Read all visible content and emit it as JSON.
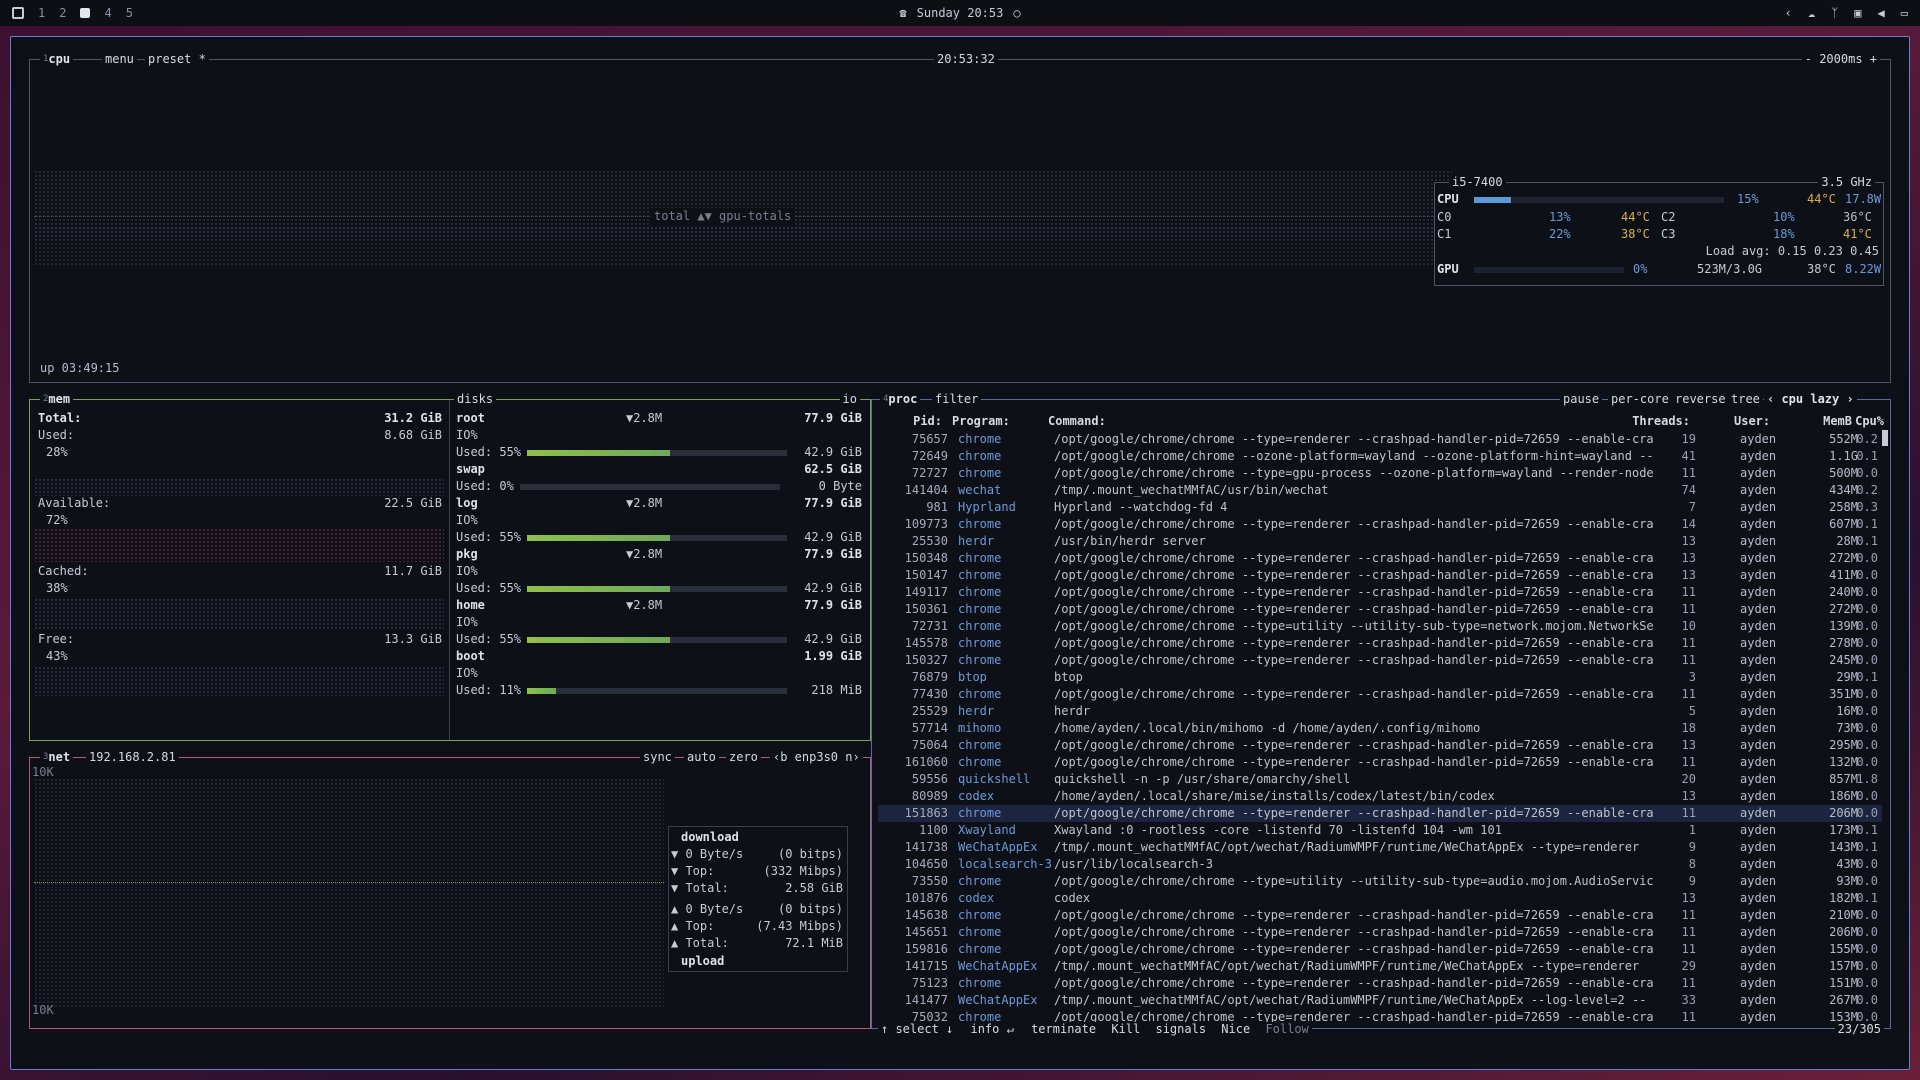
{
  "topbar": {
    "workspaces": [
      "1",
      "2",
      "3",
      "4",
      "5"
    ],
    "active_workspace": "3",
    "clock": "Sunday 20:53"
  },
  "cpu": {
    "title": "cpu",
    "title_num": "1",
    "menu": "menu",
    "preset": "preset *",
    "time": "20:53:32",
    "interval": "- 2000ms +",
    "graph_label": "total ▲▼ gpu-totals",
    "uptime": "up 03:49:15",
    "model": "i5-7400",
    "freq": "3.5 GHz",
    "cpu_row": {
      "label": "CPU",
      "pct": "15%",
      "temp": "44°C",
      "watt": "17.8W",
      "fill": 0.15
    },
    "cores": [
      {
        "label": "C0",
        "pct": "13%",
        "temp": "44°C"
      },
      {
        "label": "C2",
        "pct": "10%",
        "temp": "36°C"
      },
      {
        "label": "C1",
        "pct": "22%",
        "temp": "38°C"
      },
      {
        "label": "C3",
        "pct": "18%",
        "temp": "41°C"
      }
    ],
    "load_avg": "Load avg: 0.15 0.23 0.45",
    "gpu_row": {
      "label": "GPU",
      "pct": "0%",
      "mem": "523M/3.0G",
      "temp": "38°C",
      "watt": "8.22W"
    }
  },
  "mem": {
    "title": "mem",
    "title_num": "2",
    "total_label": "Total:",
    "total": "31.2 GiB",
    "used_label": "Used:",
    "used": "8.68 GiB",
    "used_pct": "28%",
    "available_label": "Available:",
    "available": "22.5 GiB",
    "available_pct": "72%",
    "cached_label": "Cached:",
    "cached": "11.7 GiB",
    "cached_pct": "38%",
    "free_label": "Free:",
    "free": "13.3 GiB",
    "free_pct": "43%"
  },
  "disks": {
    "title": "disks",
    "io": "io",
    "items": [
      {
        "name": "root",
        "io": "▼2.8M",
        "size": "77.9 GiB",
        "io_label": "IO%",
        "used_label": "Used: 55%",
        "used": "42.9 GiB",
        "fill": 0.55
      },
      {
        "name": "swap",
        "io": "",
        "size": "62.5 GiB",
        "io_label": "",
        "used_label": "Used:  0%",
        "used": "0 Byte",
        "fill": 0
      },
      {
        "name": "log",
        "io": "▼2.8M",
        "size": "77.9 GiB",
        "io_label": "IO%",
        "used_label": "Used: 55%",
        "used": "42.9 GiB",
        "fill": 0.55
      },
      {
        "name": "pkg",
        "io": "▼2.8M",
        "size": "77.9 GiB",
        "io_label": "IO%",
        "used_label": "Used: 55%",
        "used": "42.9 GiB",
        "fill": 0.55
      },
      {
        "name": "home",
        "io": "▼2.8M",
        "size": "77.9 GiB",
        "io_label": "IO%",
        "used_label": "Used: 55%",
        "used": "42.9 GiB",
        "fill": 0.55
      },
      {
        "name": "boot",
        "io": "",
        "size": "1.99 GiB",
        "io_label": "IO%",
        "used_label": "Used: 11%",
        "used": "218 MiB",
        "fill": 0.11
      }
    ]
  },
  "net": {
    "title": "net",
    "title_num": "3",
    "ip": "192.168.2.81",
    "sync": "sync",
    "auto": "auto",
    "zero": "zero",
    "iface": "‹b enp3s0 n›",
    "scale_top": "10K",
    "scale_bottom": "10K",
    "download_label": "download",
    "upload_label": "upload",
    "download": [
      {
        "k": "▼ 0 Byte/s",
        "v": "(0 bitps)"
      },
      {
        "k": "▼ Top:",
        "v": "(332 Mibps)"
      },
      {
        "k": "▼ Total:",
        "v": "2.58 GiB"
      }
    ],
    "upload": [
      {
        "k": "▲ 0 Byte/s",
        "v": "(0 bitps)"
      },
      {
        "k": "▲ Top:",
        "v": "(7.43 Mibps)"
      },
      {
        "k": "▲ Total:",
        "v": "72.1 MiB"
      }
    ]
  },
  "proc": {
    "title": "proc",
    "title_num": "4",
    "filter": "filter",
    "options": [
      "pause",
      "per-core",
      "reverse",
      "tree",
      "‹ cpu lazy ›"
    ],
    "headers": {
      "pid": "Pid:",
      "program": "Program:",
      "command": "Command:",
      "threads": "Threads:",
      "user": "User:",
      "mem": "MemB",
      "cpu": "Cpu%"
    },
    "rows": [
      {
        "pid": "75657",
        "prog": "chrome",
        "cmd": "/opt/google/chrome/chrome --type=renderer --crashpad-handler-pid=72659 --enable-cra",
        "thr": "19",
        "user": "ayden",
        "mem": "552M",
        "cpu": "0.2"
      },
      {
        "pid": "72649",
        "prog": "chrome",
        "cmd": "/opt/google/chrome/chrome --ozone-platform=wayland --ozone-platform-hint=wayland --",
        "thr": "41",
        "user": "ayden",
        "mem": "1.1G",
        "cpu": "0.1"
      },
      {
        "pid": "72727",
        "prog": "chrome",
        "cmd": "/opt/google/chrome/chrome --type=gpu-process --ozone-platform=wayland --render-node",
        "thr": "11",
        "user": "ayden",
        "mem": "500M",
        "cpu": "0.0"
      },
      {
        "pid": "141404",
        "prog": "wechat",
        "cmd": "/tmp/.mount_wechatMMfAC/usr/bin/wechat",
        "thr": "74",
        "user": "ayden",
        "mem": "434M",
        "cpu": "0.2"
      },
      {
        "pid": "981",
        "prog": "Hyprland",
        "cmd": "Hyprland --watchdog-fd 4",
        "thr": "7",
        "user": "ayden",
        "mem": "258M",
        "cpu": "0.3"
      },
      {
        "pid": "109773",
        "prog": "chrome",
        "cmd": "/opt/google/chrome/chrome --type=renderer --crashpad-handler-pid=72659 --enable-cra",
        "thr": "14",
        "user": "ayden",
        "mem": "607M",
        "cpu": "0.1"
      },
      {
        "pid": "25530",
        "prog": "herdr",
        "cmd": "/usr/bin/herdr server",
        "thr": "13",
        "user": "ayden",
        "mem": "28M",
        "cpu": "0.1"
      },
      {
        "pid": "150348",
        "prog": "chrome",
        "cmd": "/opt/google/chrome/chrome --type=renderer --crashpad-handler-pid=72659 --enable-cra",
        "thr": "13",
        "user": "ayden",
        "mem": "272M",
        "cpu": "0.0"
      },
      {
        "pid": "150147",
        "prog": "chrome",
        "cmd": "/opt/google/chrome/chrome --type=renderer --crashpad-handler-pid=72659 --enable-cra",
        "thr": "13",
        "user": "ayden",
        "mem": "411M",
        "cpu": "0.0"
      },
      {
        "pid": "149117",
        "prog": "chrome",
        "cmd": "/opt/google/chrome/chrome --type=renderer --crashpad-handler-pid=72659 --enable-cra",
        "thr": "11",
        "user": "ayden",
        "mem": "240M",
        "cpu": "0.0"
      },
      {
        "pid": "150361",
        "prog": "chrome",
        "cmd": "/opt/google/chrome/chrome --type=renderer --crashpad-handler-pid=72659 --enable-cra",
        "thr": "11",
        "user": "ayden",
        "mem": "272M",
        "cpu": "0.0"
      },
      {
        "pid": "72731",
        "prog": "chrome",
        "cmd": "/opt/google/chrome/chrome --type=utility --utility-sub-type=network.mojom.NetworkSe",
        "thr": "10",
        "user": "ayden",
        "mem": "139M",
        "cpu": "0.0"
      },
      {
        "pid": "145578",
        "prog": "chrome",
        "cmd": "/opt/google/chrome/chrome --type=renderer --crashpad-handler-pid=72659 --enable-cra",
        "thr": "11",
        "user": "ayden",
        "mem": "278M",
        "cpu": "0.0"
      },
      {
        "pid": "150327",
        "prog": "chrome",
        "cmd": "/opt/google/chrome/chrome --type=renderer --crashpad-handler-pid=72659 --enable-cra",
        "thr": "11",
        "user": "ayden",
        "mem": "245M",
        "cpu": "0.0"
      },
      {
        "pid": "76879",
        "prog": "btop",
        "cmd": "btop",
        "thr": "3",
        "user": "ayden",
        "mem": "29M",
        "cpu": "0.1"
      },
      {
        "pid": "77430",
        "prog": "chrome",
        "cmd": "/opt/google/chrome/chrome --type=renderer --crashpad-handler-pid=72659 --enable-cra",
        "thr": "11",
        "user": "ayden",
        "mem": "351M",
        "cpu": "0.0"
      },
      {
        "pid": "25529",
        "prog": "herdr",
        "cmd": "herdr",
        "thr": "5",
        "user": "ayden",
        "mem": "16M",
        "cpu": "0.0"
      },
      {
        "pid": "57714",
        "prog": "mihomo",
        "cmd": "/home/ayden/.local/bin/mihomo -d /home/ayden/.config/mihomo",
        "thr": "18",
        "user": "ayden",
        "mem": "73M",
        "cpu": "0.0"
      },
      {
        "pid": "75064",
        "prog": "chrome",
        "cmd": "/opt/google/chrome/chrome --type=renderer --crashpad-handler-pid=72659 --enable-cra",
        "thr": "13",
        "user": "ayden",
        "mem": "295M",
        "cpu": "0.0"
      },
      {
        "pid": "161060",
        "prog": "chrome",
        "cmd": "/opt/google/chrome/chrome --type=renderer --crashpad-handler-pid=72659 --enable-cra",
        "thr": "11",
        "user": "ayden",
        "mem": "132M",
        "cpu": "0.0"
      },
      {
        "pid": "59556",
        "prog": "quickshell",
        "cmd": "quickshell -n -p /usr/share/omarchy/shell",
        "thr": "20",
        "user": "ayden",
        "mem": "857M",
        "cpu": "1.8"
      },
      {
        "pid": "80989",
        "prog": "codex",
        "cmd": "/home/ayden/.local/share/mise/installs/codex/latest/bin/codex",
        "thr": "13",
        "user": "ayden",
        "mem": "186M",
        "cpu": "0.0"
      },
      {
        "pid": "151863",
        "prog": "chrome",
        "cmd": "/opt/google/chrome/chrome --type=renderer --crashpad-handler-pid=72659 --enable-cra",
        "thr": "11",
        "user": "ayden",
        "mem": "206M",
        "cpu": "0.0"
      },
      {
        "pid": "1100",
        "prog": "Xwayland",
        "cmd": "Xwayland :0 -rootless -core -listenfd 70 -listenfd 104 -wm 101",
        "thr": "1",
        "user": "ayden",
        "mem": "173M",
        "cpu": "0.1"
      },
      {
        "pid": "141738",
        "prog": "WeChatAppEx",
        "cmd": "/tmp/.mount_wechatMMfAC/opt/wechat/RadiumWMPF/runtime/WeChatAppEx --type=renderer",
        "thr": "9",
        "user": "ayden",
        "mem": "143M",
        "cpu": "0.1"
      },
      {
        "pid": "104650",
        "prog": "localsearch-3",
        "cmd": "/usr/lib/localsearch-3",
        "thr": "8",
        "user": "ayden",
        "mem": "43M",
        "cpu": "0.0"
      },
      {
        "pid": "73550",
        "prog": "chrome",
        "cmd": "/opt/google/chrome/chrome --type=utility --utility-sub-type=audio.mojom.AudioServic",
        "thr": "9",
        "user": "ayden",
        "mem": "93M",
        "cpu": "0.0"
      },
      {
        "pid": "101876",
        "prog": "codex",
        "cmd": "codex",
        "thr": "13",
        "user": "ayden",
        "mem": "182M",
        "cpu": "0.1"
      },
      {
        "pid": "145638",
        "prog": "chrome",
        "cmd": "/opt/google/chrome/chrome --type=renderer --crashpad-handler-pid=72659 --enable-cra",
        "thr": "11",
        "user": "ayden",
        "mem": "210M",
        "cpu": "0.0"
      },
      {
        "pid": "145651",
        "prog": "chrome",
        "cmd": "/opt/google/chrome/chrome --type=renderer --crashpad-handler-pid=72659 --enable-cra",
        "thr": "11",
        "user": "ayden",
        "mem": "206M",
        "cpu": "0.0"
      },
      {
        "pid": "159816",
        "prog": "chrome",
        "cmd": "/opt/google/chrome/chrome --type=renderer --crashpad-handler-pid=72659 --enable-cra",
        "thr": "11",
        "user": "ayden",
        "mem": "155M",
        "cpu": "0.0"
      },
      {
        "pid": "141715",
        "prog": "WeChatAppEx",
        "cmd": "/tmp/.mount_wechatMMfAC/opt/wechat/RadiumWMPF/runtime/WeChatAppEx --type=renderer",
        "thr": "29",
        "user": "ayden",
        "mem": "157M",
        "cpu": "0.0"
      },
      {
        "pid": "75123",
        "prog": "chrome",
        "cmd": "/opt/google/chrome/chrome --type=renderer --crashpad-handler-pid=72659 --enable-cra",
        "thr": "11",
        "user": "ayden",
        "mem": "151M",
        "cpu": "0.0"
      },
      {
        "pid": "141477",
        "prog": "WeChatAppEx",
        "cmd": "/tmp/.mount_wechatMMfAC/opt/wechat/RadiumWMPF/runtime/WeChatAppEx --log-level=2 --",
        "thr": "33",
        "user": "ayden",
        "mem": "267M",
        "cpu": "0.0"
      },
      {
        "pid": "75032",
        "prog": "chrome",
        "cmd": "/opt/google/chrome/chrome --type=renderer --crashpad-handler-pid=72659 --enable-cra",
        "thr": "11",
        "user": "ayden",
        "mem": "153M",
        "cpu": "0.0"
      }
    ],
    "selected_index": 22,
    "footer": {
      "select": "↑ select ↓",
      "info": "info ↵",
      "terminate": "terminate",
      "kill": "Kill",
      "signals": "signals",
      "nice": "Nice",
      "follow": "Follow"
    },
    "count": "23/305"
  },
  "colors": {
    "accent": "#6c7bd0",
    "mem_border": "#7fa04a",
    "net_border": "#b85a70",
    "program": "#6c9ad8"
  }
}
